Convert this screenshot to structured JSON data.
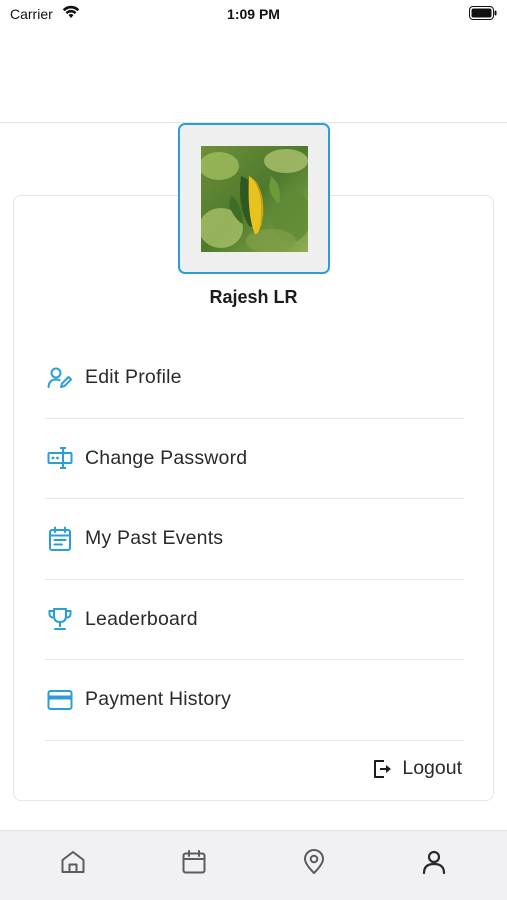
{
  "status_bar": {
    "carrier": "Carrier",
    "time": "1:09 PM",
    "wifi_icon": "wifi-icon",
    "battery_icon": "battery-icon"
  },
  "profile": {
    "name": "Rajesh LR",
    "avatar": "profile-photo-leaves"
  },
  "menu": {
    "items": [
      {
        "label": "Edit Profile",
        "icon": "edit-user-icon"
      },
      {
        "label": "Change Password",
        "icon": "password-icon"
      },
      {
        "label": "My Past Events",
        "icon": "calendar-list-icon"
      },
      {
        "label": "Leaderboard",
        "icon": "trophy-icon"
      },
      {
        "label": "Payment History",
        "icon": "credit-card-icon"
      }
    ],
    "logout_label": "Logout",
    "logout_icon": "logout-icon"
  },
  "tab_bar": {
    "tabs": [
      {
        "name": "home",
        "icon": "home-icon"
      },
      {
        "name": "calendar",
        "icon": "calendar-icon"
      },
      {
        "name": "location",
        "icon": "location-pin-icon"
      },
      {
        "name": "profile",
        "icon": "user-icon"
      }
    ]
  },
  "colors": {
    "accent": "#2a9fd6",
    "icon_gray": "#5b5b60",
    "divider": "#e8e8ec",
    "tab_bar_bg": "#f1f1f3"
  }
}
